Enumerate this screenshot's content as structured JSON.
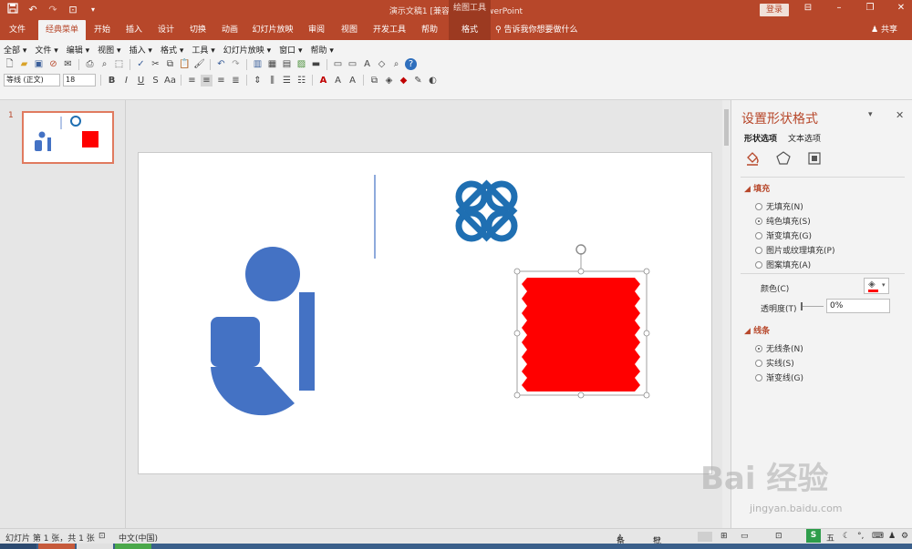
{
  "window": {
    "title": "演示文稿1 [兼容模式] - PowerPoint",
    "context_tool": "绘图工具",
    "login_label": "登录"
  },
  "tabs": [
    {
      "label": "文件"
    },
    {
      "label": "经典菜单"
    },
    {
      "label": "开始"
    },
    {
      "label": "插入"
    },
    {
      "label": "设计"
    },
    {
      "label": "切换"
    },
    {
      "label": "动画"
    },
    {
      "label": "幻灯片放映"
    },
    {
      "label": "审阅"
    },
    {
      "label": "视图"
    },
    {
      "label": "开发工具"
    },
    {
      "label": "帮助"
    },
    {
      "label": "格式"
    }
  ],
  "tell_me": "告诉我你想要做什么",
  "share_label": "共享",
  "menu": [
    "全部 ▾",
    "文件 ▾",
    "编辑 ▾",
    "视图 ▾",
    "插入 ▾",
    "格式 ▾",
    "工具 ▾",
    "幻灯片放映 ▾",
    "窗口 ▾",
    "帮助 ▾"
  ],
  "font": {
    "name": "等线 (正文)",
    "size": "18"
  },
  "slides": [
    {
      "number": "1"
    }
  ],
  "format_pane": {
    "title": "设置形状格式",
    "subtab_shape": "形状选项",
    "subtab_text": "文本选项",
    "fill_section": "填充",
    "fill_options": [
      "无填充(N)",
      "纯色填充(S)",
      "渐变填充(G)",
      "图片或纹理填充(P)",
      "图案填充(A)"
    ],
    "fill_selected": 1,
    "color_label": "颜色(C)",
    "transparency_label": "透明度(T)",
    "transparency_value": "0%",
    "line_section": "线条",
    "line_options": [
      "无线条(N)",
      "实线(S)",
      "渐变线(G)"
    ],
    "line_selected": 0
  },
  "status": {
    "slide_info": "幻灯片 第 1 张，共 1 张",
    "language": "中文(中国)",
    "notes": "备注",
    "comments": "批注"
  },
  "watermark": {
    "brand": "Bai  经验",
    "url": "jingyan.baidu.com"
  },
  "colors": {
    "accent": "#b7472a",
    "shape_blue": "#4472c4",
    "shape_red": "#ff0000",
    "logo_blue": "#1f6fb2"
  }
}
